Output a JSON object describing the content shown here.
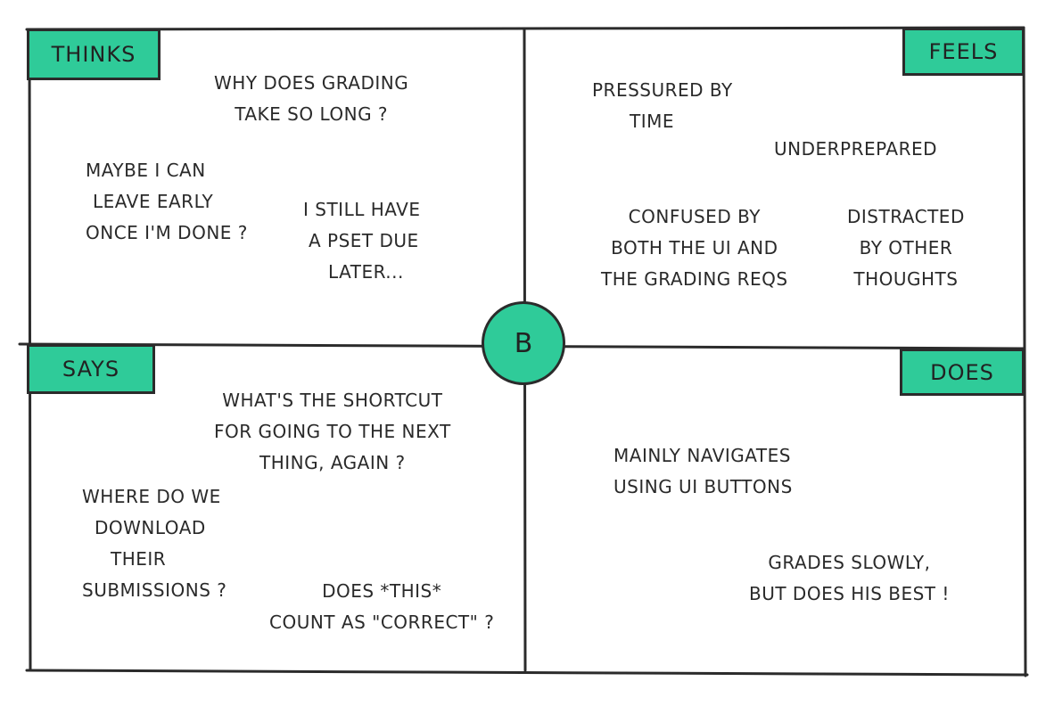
{
  "quadrants": {
    "thinks": {
      "label": "THINKS",
      "notes": [
        [
          "WHY DOES GRADING",
          "TAKE SO LONG ?"
        ],
        [
          "MAYBE I CAN",
          "LEAVE EARLY",
          "ONCE I'M DONE ?"
        ],
        [
          "I STILL HAVE",
          "A PSET DUE",
          "LATER..."
        ]
      ]
    },
    "feels": {
      "label": "FEELS",
      "notes": [
        [
          "PRESSURED BY",
          "TIME"
        ],
        [
          "UNDERPREPARED"
        ],
        [
          "CONFUSED BY",
          "BOTH THE UI AND",
          "THE GRADING REQS"
        ],
        [
          "DISTRACTED",
          "BY OTHER",
          "THOUGHTS"
        ]
      ]
    },
    "says": {
      "label": "SAYS",
      "notes": [
        [
          "WHAT'S THE SHORTCUT",
          "FOR GOING TO THE NEXT",
          "THING, AGAIN ?"
        ],
        [
          "WHERE DO WE",
          "DOWNLOAD",
          "THEIR",
          "SUBMISSIONS ?"
        ],
        [
          "DOES *THIS*",
          "COUNT AS \"CORRECT\" ?"
        ]
      ]
    },
    "does": {
      "label": "DOES",
      "notes": [
        [
          "MAINLY NAVIGATES",
          "USING UI BUTTONS"
        ],
        [
          "GRADES SLOWLY,",
          "BUT DOES HIS BEST !"
        ]
      ]
    }
  },
  "center_label": "B",
  "colors": {
    "accent": "#2fcb99",
    "ink": "#2b2b2b"
  }
}
